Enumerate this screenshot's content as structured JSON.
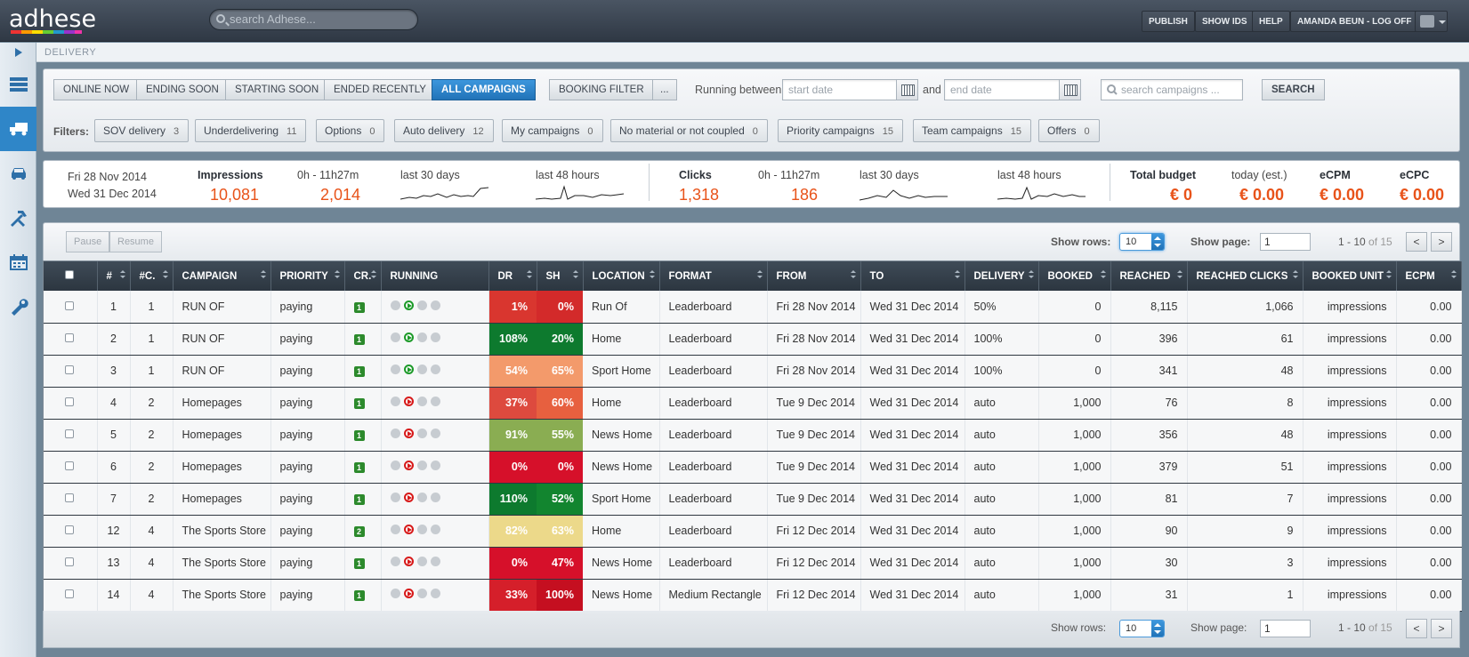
{
  "app": {
    "logo": "adhese",
    "search_placeholder": "search Adhese..."
  },
  "topnav": {
    "publish": "PUBLISH",
    "show_ids": "SHOW IDS",
    "help": "HELP",
    "user": "AMANDA BEUN - LOG OFF"
  },
  "breadcrumb": "DELIVERY",
  "sidebar": {
    "items": [
      "list-icon",
      "truck-icon",
      "car-icon",
      "tools-icon",
      "calendar-icon",
      "wrench-icon"
    ],
    "active": 1
  },
  "toolbar": {
    "tabs": [
      "ONLINE NOW",
      "ENDING SOON",
      "STARTING SOON",
      "ENDED RECENTLY",
      "ALL CAMPAIGNS"
    ],
    "active_tab": 4,
    "booking_filter": "BOOKING FILTER",
    "more": "...",
    "running_between": "Running between",
    "and": "and",
    "start_placeholder": "start date",
    "end_placeholder": "end date",
    "search_placeholder": "search campaigns ...",
    "search_button": "SEARCH"
  },
  "filters": {
    "label": "Filters:",
    "items": [
      {
        "label": "SOV delivery",
        "count": "3"
      },
      {
        "label": "Underdelivering",
        "count": "11"
      },
      {
        "label": "Options",
        "count": "0"
      },
      {
        "label": "Auto delivery",
        "count": "12"
      },
      {
        "label": "My campaigns",
        "count": "0"
      },
      {
        "label": "No material or not coupled",
        "count": "0"
      },
      {
        "label": "Priority campaigns",
        "count": "15"
      },
      {
        "label": "Team campaigns",
        "count": "15"
      },
      {
        "label": "Offers",
        "count": "0"
      }
    ]
  },
  "stats": {
    "date_from": "Fri 28 Nov 2014",
    "date_to": "Wed 31 Dec 2014",
    "impressions": {
      "label": "Impressions",
      "value": "10,081",
      "range_label": "0h - 11h27m",
      "range_value": "2,014",
      "last30": "last 30 days",
      "last48": "last 48 hours"
    },
    "clicks": {
      "label": "Clicks",
      "value": "1,318",
      "range_label": "0h - 11h27m",
      "range_value": "186",
      "last30": "last 30 days",
      "last48": "last 48 hours"
    },
    "budget": {
      "label": "Total budget",
      "value": "€ 0"
    },
    "today": {
      "label": "today (est.)",
      "value": "€ 0.00"
    },
    "ecpm": {
      "label": "eCPM",
      "value": "€ 0.00"
    },
    "ecpc": {
      "label": "eCPC",
      "value": "€ 0.00"
    }
  },
  "table_controls": {
    "pause": "Pause",
    "resume": "Resume",
    "show_rows_label": "Show rows:",
    "show_rows": "10",
    "show_page_label": "Show page:",
    "page": "1",
    "range": "1 - 10",
    "of_total": "of 15",
    "prev": "<",
    "next": ">"
  },
  "columns": [
    "",
    "#",
    "#C.",
    "CAMPAIGN",
    "PRIORITY",
    "CR.",
    "RUNNING",
    "DR",
    "SH",
    "LOCATION",
    "FORMAT",
    "FROM",
    "TO",
    "DELIVERY",
    "BOOKED",
    "REACHED",
    "REACHED CLICKS",
    "BOOKED UNIT",
    "ECPM"
  ],
  "rows": [
    {
      "id": "1",
      "c": "1",
      "campaign": "RUN OF",
      "priority": "paying",
      "cr": "1",
      "state": "play",
      "dr": "1%",
      "sh": "0%",
      "drc": "#d9362f",
      "shc": "#d32a2a",
      "location": "Run Of",
      "format": "Leaderboard",
      "from": "Fri 28 Nov 2014",
      "to": "Wed 31 Dec 2014",
      "delivery": "50%",
      "booked": "0",
      "reached": "8,115",
      "clicks": "1,066",
      "unit": "impressions",
      "ecpm": "0.00"
    },
    {
      "id": "2",
      "c": "1",
      "campaign": "RUN OF",
      "priority": "paying",
      "cr": "1",
      "state": "play",
      "dr": "108%",
      "sh": "20%",
      "drc": "#0d7a2e",
      "shc": "#0d7a2e",
      "location": "Home",
      "format": "Leaderboard",
      "from": "Fri 28 Nov 2014",
      "to": "Wed 31 Dec 2014",
      "delivery": "100%",
      "booked": "0",
      "reached": "396",
      "clicks": "61",
      "unit": "impressions",
      "ecpm": "0.00"
    },
    {
      "id": "3",
      "c": "1",
      "campaign": "RUN OF",
      "priority": "paying",
      "cr": "1",
      "state": "play",
      "dr": "54%",
      "sh": "65%",
      "drc": "#f39a6b",
      "shc": "#f39a6b",
      "location": "Sport Home",
      "format": "Leaderboard",
      "from": "Fri 28 Nov 2014",
      "to": "Wed 31 Dec 2014",
      "delivery": "100%",
      "booked": "0",
      "reached": "341",
      "clicks": "48",
      "unit": "impressions",
      "ecpm": "0.00"
    },
    {
      "id": "4",
      "c": "2",
      "campaign": "Homepages",
      "priority": "paying",
      "cr": "1",
      "state": "stop",
      "dr": "37%",
      "sh": "60%",
      "drc": "#dd4a3e",
      "shc": "#e7603f",
      "location": "Home",
      "format": "Leaderboard",
      "from": "Tue 9 Dec 2014",
      "to": "Wed 31 Dec 2014",
      "delivery": "auto",
      "booked": "1,000",
      "reached": "76",
      "clicks": "8",
      "unit": "impressions",
      "ecpm": "0.00"
    },
    {
      "id": "5",
      "c": "2",
      "campaign": "Homepages",
      "priority": "paying",
      "cr": "1",
      "state": "stop",
      "dr": "91%",
      "sh": "55%",
      "drc": "#8aad52",
      "shc": "#8aad52",
      "location": "News Home",
      "format": "Leaderboard",
      "from": "Tue 9 Dec 2014",
      "to": "Wed 31 Dec 2014",
      "delivery": "auto",
      "booked": "1,000",
      "reached": "356",
      "clicks": "48",
      "unit": "impressions",
      "ecpm": "0.00"
    },
    {
      "id": "6",
      "c": "2",
      "campaign": "Homepages",
      "priority": "paying",
      "cr": "1",
      "state": "stop",
      "dr": "0%",
      "sh": "0%",
      "drc": "#d6102a",
      "shc": "#d6102a",
      "location": "News Home",
      "format": "Leaderboard",
      "from": "Tue 9 Dec 2014",
      "to": "Wed 31 Dec 2014",
      "delivery": "auto",
      "booked": "1,000",
      "reached": "379",
      "clicks": "51",
      "unit": "impressions",
      "ecpm": "0.00"
    },
    {
      "id": "7",
      "c": "2",
      "campaign": "Homepages",
      "priority": "paying",
      "cr": "1",
      "state": "stop",
      "dr": "110%",
      "sh": "52%",
      "drc": "#0d7a2e",
      "shc": "#12852f",
      "location": "Sport Home",
      "format": "Leaderboard",
      "from": "Tue 9 Dec 2014",
      "to": "Wed 31 Dec 2014",
      "delivery": "auto",
      "booked": "1,000",
      "reached": "81",
      "clicks": "7",
      "unit": "impressions",
      "ecpm": "0.00"
    },
    {
      "id": "12",
      "c": "4",
      "campaign": "The Sports Store",
      "priority": "paying",
      "cr": "2",
      "state": "stop",
      "dr": "82%",
      "sh": "63%",
      "drc": "#ecd98a",
      "shc": "#ecd98a",
      "location": "Home",
      "format": "Leaderboard",
      "from": "Fri 12 Dec 2014",
      "to": "Wed 31 Dec 2014",
      "delivery": "auto",
      "booked": "1,000",
      "reached": "90",
      "clicks": "9",
      "unit": "impressions",
      "ecpm": "0.00"
    },
    {
      "id": "13",
      "c": "4",
      "campaign": "The Sports Store",
      "priority": "paying",
      "cr": "1",
      "state": "stop",
      "dr": "0%",
      "sh": "47%",
      "drc": "#d6102a",
      "shc": "#d6102a",
      "location": "News Home",
      "format": "Leaderboard",
      "from": "Fri 12 Dec 2014",
      "to": "Wed 31 Dec 2014",
      "delivery": "auto",
      "booked": "1,000",
      "reached": "30",
      "clicks": "3",
      "unit": "impressions",
      "ecpm": "0.00"
    },
    {
      "id": "14",
      "c": "4",
      "campaign": "The Sports Store",
      "priority": "paying",
      "cr": "1",
      "state": "stop",
      "dr": "33%",
      "sh": "100%",
      "drc": "#d51f2a",
      "shc": "#c50f20",
      "location": "News Home",
      "format": "Medium Rectangle",
      "from": "Fri 12 Dec 2014",
      "to": "Wed 31 Dec 2014",
      "delivery": "auto",
      "booked": "1,000",
      "reached": "31",
      "clicks": "1",
      "unit": "impressions",
      "ecpm": "0.00"
    }
  ]
}
